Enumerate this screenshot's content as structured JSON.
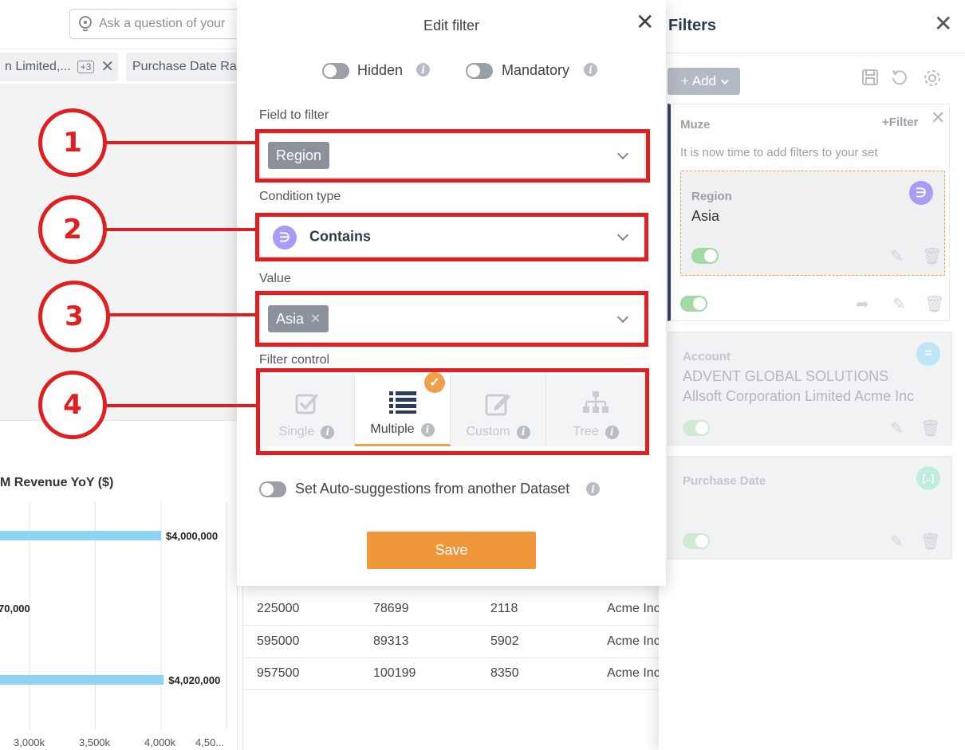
{
  "background": {
    "ask_placeholder": "Ask a question of your",
    "chip_1": {
      "label": "n Limited,...",
      "badge": "+3",
      "close": "✕"
    },
    "chip_2": {
      "label": "Purchase Date Ra"
    },
    "chart_title": "M Revenue YoY ($)",
    "chart_data": {
      "type": "bar",
      "orientation": "horizontal",
      "title": "M Revenue YoY ($)",
      "data_labels": [
        "$4,000,000",
        "70,000",
        "$4,020,000"
      ],
      "values": [
        4000000,
        null,
        4020000
      ],
      "x_tick_labels": [
        "3,000k",
        "3,500k",
        "4,000k",
        "4,50..."
      ],
      "colors": [
        "#8fd3f4"
      ],
      "grid": true
    },
    "table_rows": [
      [
        "225000",
        "78699",
        "2118",
        "Acme Inc"
      ],
      [
        "595000",
        "89313",
        "5902",
        "Acme Inc"
      ],
      [
        "957500",
        "100199",
        "8350",
        "Acme Inc"
      ]
    ]
  },
  "modal": {
    "title": "Edit filter",
    "close": "✕",
    "hidden_label": "Hidden",
    "mandatory_label": "Mandatory",
    "field_label": "Field to filter",
    "field_value": "Region",
    "condition_label": "Condition type",
    "condition_symbol": "∋",
    "condition_value": "Contains",
    "value_label": "Value",
    "value_chip": "Asia",
    "value_chip_remove": "✕",
    "filter_control_label": "Filter control",
    "controls": [
      {
        "label": "Single",
        "state": "disabled"
      },
      {
        "label": "Multiple",
        "state": "selected"
      },
      {
        "label": "Custom",
        "state": "disabled"
      },
      {
        "label": "Tree",
        "state": "disabled"
      }
    ],
    "auto_suggest_label": "Set Auto-suggestions from another Dataset",
    "save_label": "Save",
    "accent": "#f0973b"
  },
  "filters_panel": {
    "title": "Filters",
    "close": "✕",
    "add_label": "+ Add",
    "set": {
      "name": "Muze",
      "add_filter": "+Filter",
      "close": "✕",
      "hint": "It is now time to add filters to your set",
      "filter": {
        "label": "Region",
        "value": "Asia",
        "symbol": "∋",
        "color": "#a99cf5"
      }
    },
    "account": {
      "label": "Account",
      "value": "ADVENT GLOBAL SOLUTIONS Allsoft Corporation Limited Acme Inc",
      "symbol": "=",
      "color": "#7ccff0"
    },
    "purchase_date": {
      "label": "Purchase Date",
      "symbol": "[..]",
      "color": "#86e3c9"
    }
  },
  "annotations": [
    "1",
    "2",
    "3",
    "4"
  ],
  "annotation_color": "#e02020"
}
